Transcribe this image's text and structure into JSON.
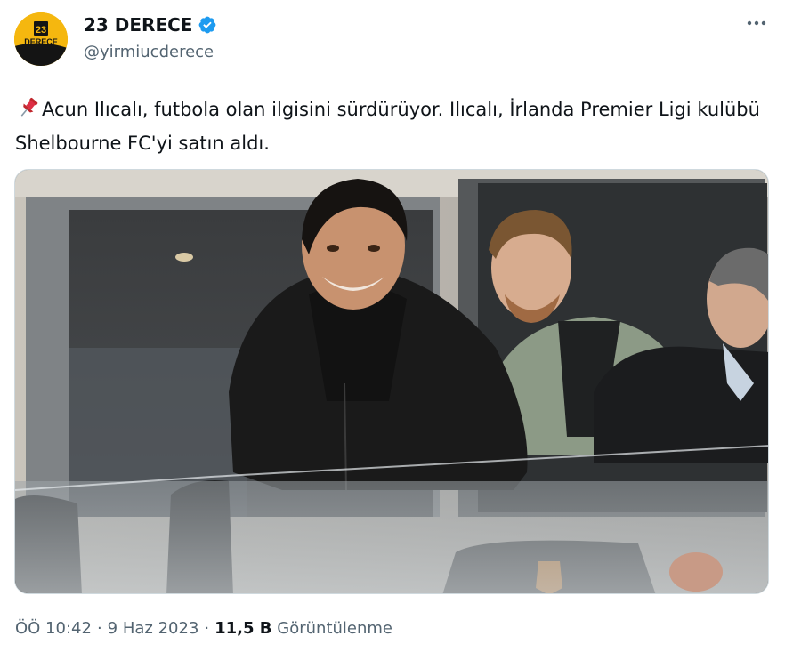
{
  "author": {
    "display_name": "23 DERECE",
    "handle": "@yirmiucderece",
    "avatar_text_top": "23",
    "avatar_text_bottom": "DERECE",
    "verified_icon": "verified-badge-icon",
    "avatar_colors": {
      "top": "#f5b70f",
      "bottom": "#141414"
    }
  },
  "menu": {
    "icon": "more-options-icon",
    "glyph": "•••"
  },
  "tweet": {
    "pin_icon": "pushpin-emoji",
    "text": "Acun Ilıcalı, futbola olan ilgisini sürdürüyor. Ilıcalı, İrlanda Premier Ligi kulübü Shelbourne FC'yi satın aldı."
  },
  "media": {
    "icon": "photo"
  },
  "footer": {
    "time": "ÖÖ 10:42",
    "date": "9 Haz 2023",
    "separator": "·",
    "views_count": "11,5 B",
    "views_label": "Görüntülenme"
  },
  "colors": {
    "text_primary": "#0f1419",
    "text_secondary": "#536471",
    "verified": "#1d9bf0",
    "border": "#cfd9de"
  }
}
